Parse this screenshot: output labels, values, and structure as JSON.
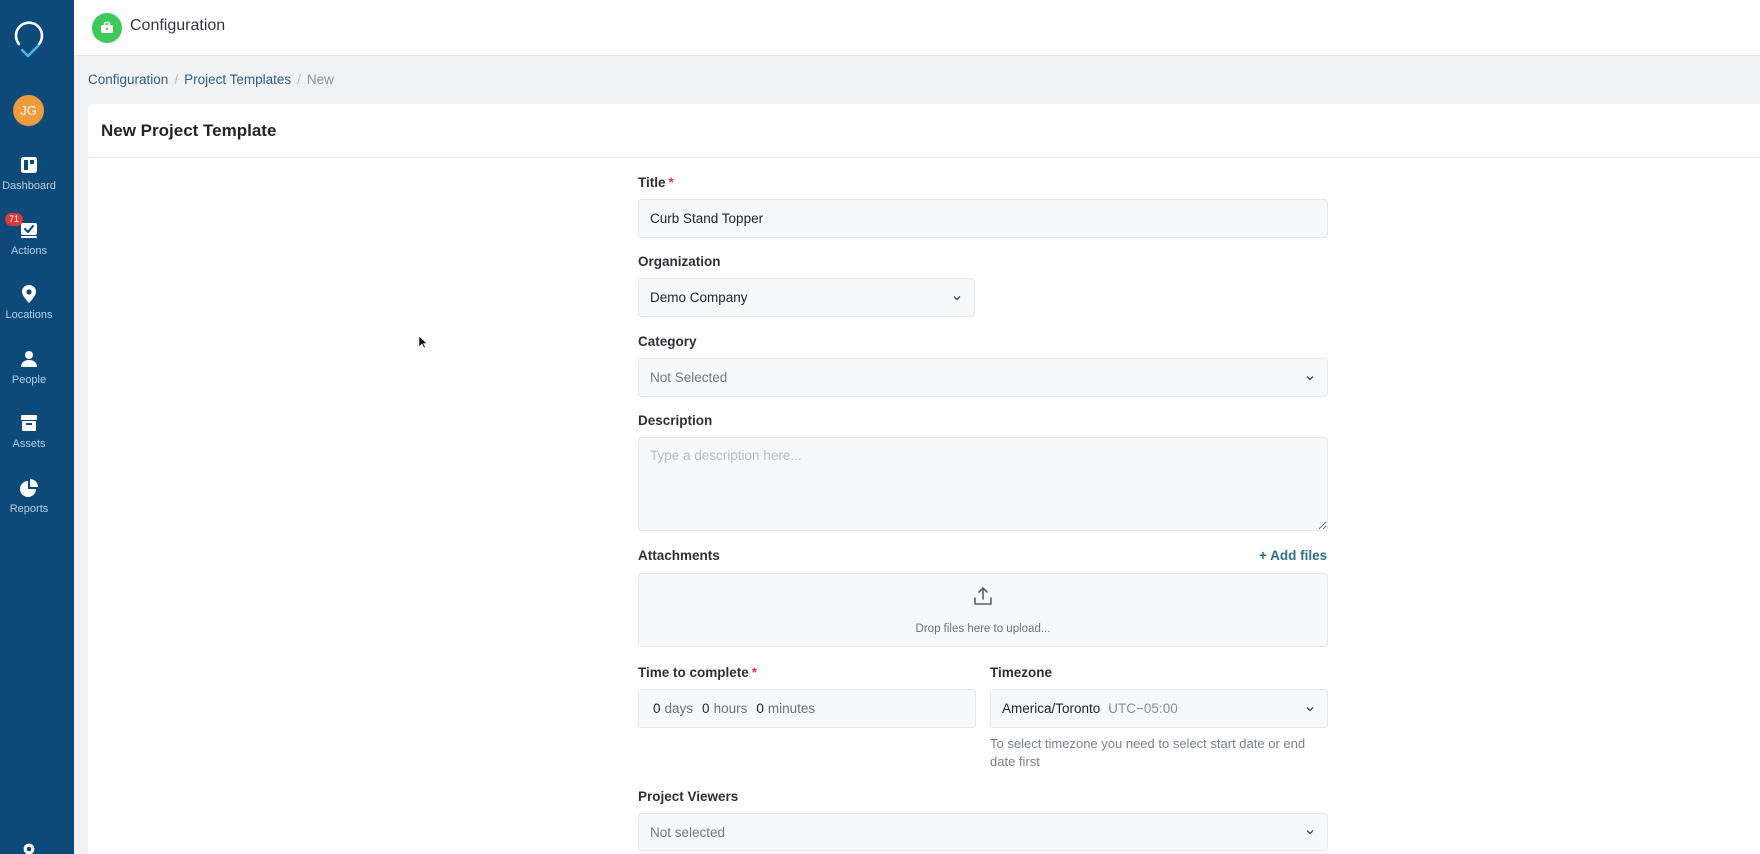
{
  "sidebar": {
    "avatar_initials": "JG",
    "items": [
      {
        "label": "Dashboard",
        "icon": "dashboard-icon"
      },
      {
        "label": "Actions",
        "icon": "actions-icon",
        "badge": "71"
      },
      {
        "label": "Locations",
        "icon": "location-pin-icon"
      },
      {
        "label": "People",
        "icon": "person-icon"
      },
      {
        "label": "Assets",
        "icon": "archive-box-icon"
      },
      {
        "label": "Reports",
        "icon": "pie-chart-icon"
      }
    ]
  },
  "header": {
    "title": "Configuration",
    "accent_color": "#3ec95a"
  },
  "breadcrumb": {
    "items": [
      "Configuration",
      "Project Templates",
      "New"
    ]
  },
  "card": {
    "title": "New Project Template"
  },
  "form": {
    "title": {
      "label": "Title",
      "required_mark": "*",
      "value": "Curb Stand Topper"
    },
    "organization": {
      "label": "Organization",
      "value": "Demo Company"
    },
    "category": {
      "label": "Category",
      "value": "Not Selected"
    },
    "description": {
      "label": "Description",
      "placeholder": "Type a description here..."
    },
    "attachments": {
      "label": "Attachments",
      "add_label": "+ Add files",
      "drop_text": "Drop files here to upload..."
    },
    "time_to_complete": {
      "label": "Time to complete",
      "required_mark": "*",
      "days_value": "0",
      "days_unit": "days",
      "hours_value": "0",
      "hours_unit": "hours",
      "minutes_value": "0",
      "minutes_unit": "minutes"
    },
    "timezone": {
      "label": "Timezone",
      "value": "America/Toronto",
      "offset": "UTC−05:00",
      "hint": "To select timezone you need to select start date or end date first"
    },
    "project_viewers": {
      "label": "Project Viewers",
      "value": "Not selected"
    }
  },
  "colors": {
    "sidebar": "#0d4a7a",
    "link": "#2f5f88",
    "required": "#d9373c",
    "badge": "#d93a3a"
  }
}
